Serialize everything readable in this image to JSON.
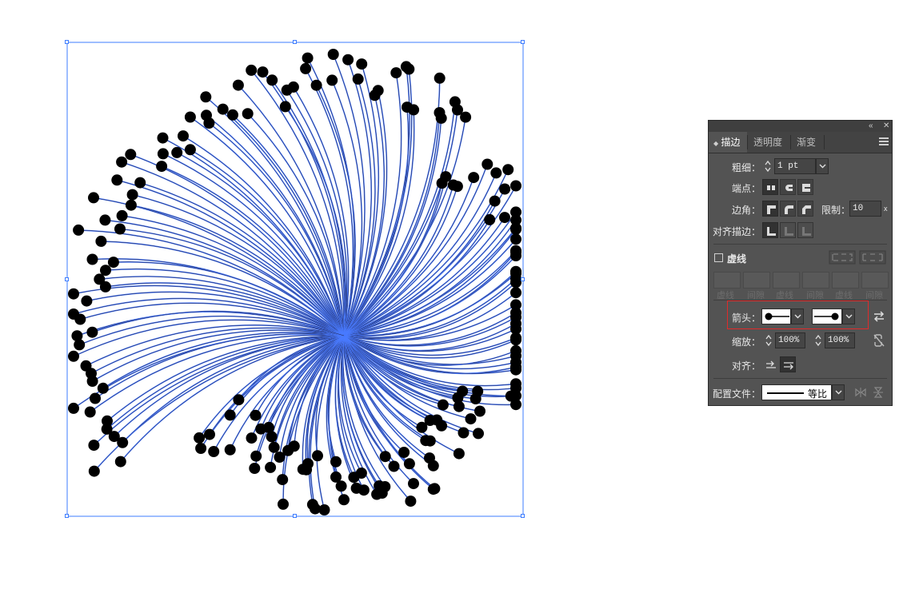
{
  "stroke_panel": {
    "tabs": [
      {
        "label": "描边",
        "active": true
      },
      {
        "label": "透明度",
        "active": false
      },
      {
        "label": "渐变",
        "active": false
      }
    ],
    "weight": {
      "label": "粗细：",
      "value": "1 pt"
    },
    "cap": {
      "label": "端点："
    },
    "corner": {
      "label": "边角：",
      "limit_label": "限制：",
      "limit_value": "10",
      "limit_unit": "x"
    },
    "align_stroke": {
      "label": "对齐描边："
    },
    "dashed": {
      "label": "虚线",
      "checked": false,
      "cells": [
        "虚线",
        "间隙",
        "虚线",
        "间隙",
        "虚线",
        "间隙"
      ]
    },
    "arrowheads": {
      "label": "箭头：",
      "start": "round-dot",
      "end": "round-dot"
    },
    "scale": {
      "label": "缩放：",
      "start": "100%",
      "end": "100%"
    },
    "align": {
      "label": "对齐："
    },
    "profile": {
      "label": "配置文件：",
      "value": "等比"
    },
    "highlight_color": "#e02b2b"
  },
  "artwork": {
    "line_color": "#4a7bff",
    "dot_color": "#000000",
    "selection_color": "#3d7cff"
  }
}
